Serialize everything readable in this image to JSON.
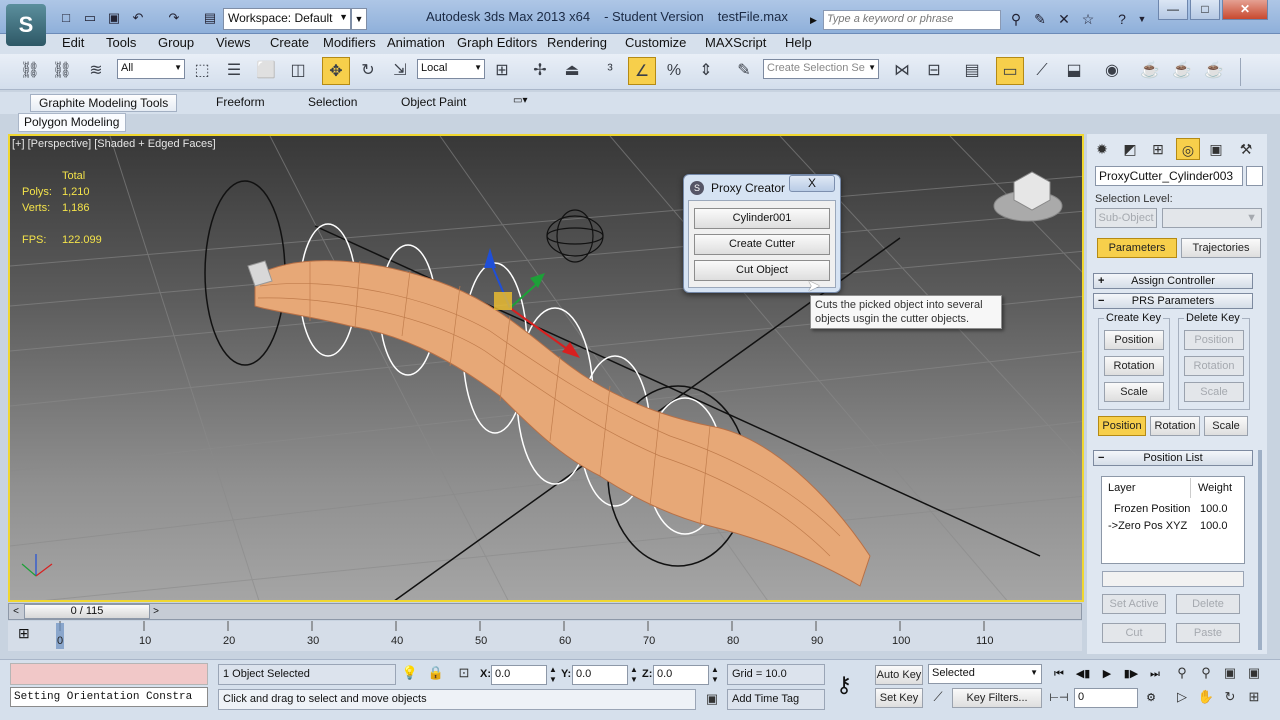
{
  "window": {
    "title_app": "Autodesk 3ds Max  2013 x64",
    "title_edition": "- Student Version",
    "title_file": "testFile.max",
    "workspace_label": "Workspace: Default",
    "search_placeholder": "Type a keyword or phrase"
  },
  "menu": [
    "Edit",
    "Tools",
    "Group",
    "Views",
    "Create",
    "Modifiers",
    "Animation",
    "Graph Editors",
    "Rendering",
    "Customize",
    "MAXScript",
    "Help"
  ],
  "toolbar": {
    "filter_select": "All",
    "coord_system": "Local",
    "named_selection": "Create Selection Se"
  },
  "ribbon": {
    "tabs": [
      "Graphite Modeling Tools",
      "Freeform",
      "Selection",
      "Object Paint"
    ],
    "sub_tab": "Polygon Modeling"
  },
  "viewport": {
    "label": "[+] [Perspective] [Shaded + Edged Faces]",
    "stats_header": "Total",
    "polys_label": "Polys:",
    "polys_value": "1,210",
    "verts_label": "Verts:",
    "verts_value": "1,186",
    "fps_label": "FPS:",
    "fps_value": "122.099"
  },
  "proxy_dialog": {
    "title": "Proxy Creator",
    "close": "X",
    "btn_pick": "Cylinder001",
    "btn_create": "Create Cutter",
    "btn_cut": "Cut Object",
    "tooltip_line1": "Cuts the picked object into several",
    "tooltip_line2": "objects usgin the cutter objects."
  },
  "command_panel": {
    "object_name": "ProxyCutter_Cylinder003",
    "selection_level_label": "Selection Level:",
    "sub_object": "Sub-Object",
    "tab_parameters": "Parameters",
    "tab_trajectories": "Trajectories",
    "rollout_assign": "Assign Controller",
    "rollout_prs": "PRS Parameters",
    "create_key_label": "Create Key",
    "delete_key_label": "Delete Key",
    "position": "Position",
    "rotation": "Rotation",
    "scale": "Scale",
    "rollout_position_list": "Position List",
    "col_layer": "Layer",
    "col_weight": "Weight",
    "list_rows": [
      {
        "layer": "Frozen Position",
        "weight": "100.0"
      },
      {
        "layer": "->Zero Pos XYZ",
        "weight": "100.0"
      }
    ],
    "set_active": "Set Active",
    "delete": "Delete",
    "cut": "Cut",
    "paste": "Paste"
  },
  "timeline": {
    "slider_label": "0 / 115",
    "ticks": [
      "0",
      "10",
      "20",
      "30",
      "40",
      "50",
      "60",
      "70",
      "80",
      "90",
      "100",
      "110"
    ]
  },
  "status": {
    "maxscript_text": "Setting Orientation Constra",
    "selection_info": "1 Object Selected",
    "prompt": "Click and drag to select and move objects",
    "x_label": "X:",
    "x_value": "0.0",
    "y_label": "Y:",
    "y_value": "0.0",
    "z_label": "Z:",
    "z_value": "0.0",
    "grid": "Grid = 10.0",
    "add_time_tag": "Add Time Tag",
    "auto_key": "Auto Key",
    "set_key": "Set Key",
    "key_mode": "Selected",
    "key_filters": "Key Filters...",
    "frame_value": "0"
  }
}
